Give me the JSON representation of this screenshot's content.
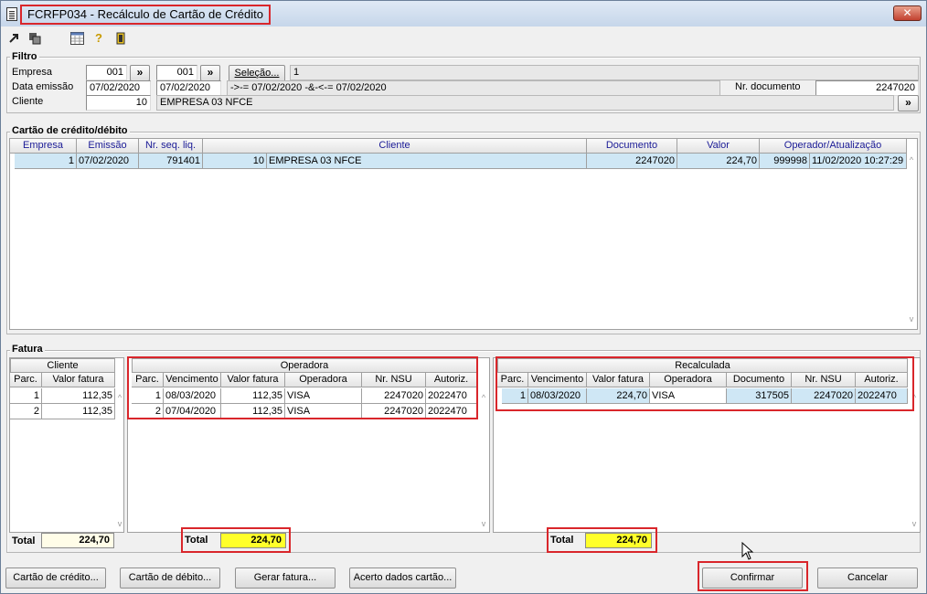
{
  "window": {
    "title": "FCRFP034 - Recálculo de Cartão de Crédito",
    "close_symbol": "✕"
  },
  "toolbar": {
    "icons": [
      "arrow-out-icon",
      "copy-icon",
      "calendar-icon",
      "help-icon",
      "exit-door-icon"
    ]
  },
  "filtro": {
    "legend": "Filtro",
    "empresa_label": "Empresa",
    "empresa_from": "001",
    "empresa_to": "001",
    "more_symbol": "»",
    "selecao_label": "Seleção...",
    "selecao_value": "1",
    "data_emissao_label": "Data emissão",
    "data_from": "07/02/2020",
    "data_to": "07/02/2020",
    "data_expr": "->-= 07/02/2020 -&-<-= 07/02/2020",
    "nr_documento_label": "Nr. documento",
    "nr_documento_value": "2247020",
    "cliente_label": "Cliente",
    "cliente_code": "10",
    "cliente_name": "EMPRESA 03 NFCE"
  },
  "cartao": {
    "legend": "Cartão de crédito/débito",
    "columns": [
      "Empresa",
      "Emissão",
      "Nr. seq. liq.",
      "Cliente",
      "Documento",
      "Valor",
      "Operador/Atualização"
    ],
    "rows": [
      {
        "empresa": "1",
        "emissao": "07/02/2020",
        "nr_seq": "791401",
        "cliente_code": "10",
        "cliente_name": "EMPRESA 03 NFCE",
        "documento": "2247020",
        "valor": "224,70",
        "operador": "999998",
        "atualizacao": "11/02/2020 10:27:29"
      }
    ]
  },
  "fatura": {
    "legend": "Fatura",
    "cliente": {
      "caption": "Cliente",
      "columns": [
        "Parc.",
        "Valor fatura"
      ],
      "rows": [
        {
          "parc": "1",
          "valor": "112,35"
        },
        {
          "parc": "2",
          "valor": "112,35"
        }
      ],
      "total_label": "Total",
      "total_value": "224,70"
    },
    "operadora": {
      "caption": "Operadora",
      "columns": [
        "Parc.",
        "Vencimento",
        "Valor fatura",
        "Operadora",
        "Nr. NSU",
        "Autoriz."
      ],
      "rows": [
        {
          "parc": "1",
          "vencimento": "08/03/2020",
          "valor": "112,35",
          "operadora": "VISA",
          "nsu": "2247020",
          "autoriz": "2022470"
        },
        {
          "parc": "2",
          "vencimento": "07/04/2020",
          "valor": "112,35",
          "operadora": "VISA",
          "nsu": "2247020",
          "autoriz": "2022470"
        }
      ],
      "total_label": "Total",
      "total_value": "224,70"
    },
    "recalculada": {
      "caption": "Recalculada",
      "columns": [
        "Parc.",
        "Vencimento",
        "Valor fatura",
        "Operadora",
        "Documento",
        "Nr. NSU",
        "Autoriz."
      ],
      "rows": [
        {
          "parc": "1",
          "vencimento": "08/03/2020",
          "valor": "224,70",
          "operadora": "VISA",
          "documento": "317505",
          "nsu": "2247020",
          "autoriz": "2022470"
        }
      ],
      "total_label": "Total",
      "total_value": "224,70"
    }
  },
  "buttons": {
    "cartao_credito": "Cartão de crédito...",
    "cartao_debito": "Cartão de débito...",
    "gerar_fatura": "Gerar fatura...",
    "acerto_dados": "Acerto dados cartão...",
    "confirmar": "Confirmar",
    "cancelar": "Cancelar"
  },
  "colors": {
    "highlight_box": "#d9262b",
    "total_yellow": "#ffff2a",
    "selected_row": "#cfe7f5"
  }
}
